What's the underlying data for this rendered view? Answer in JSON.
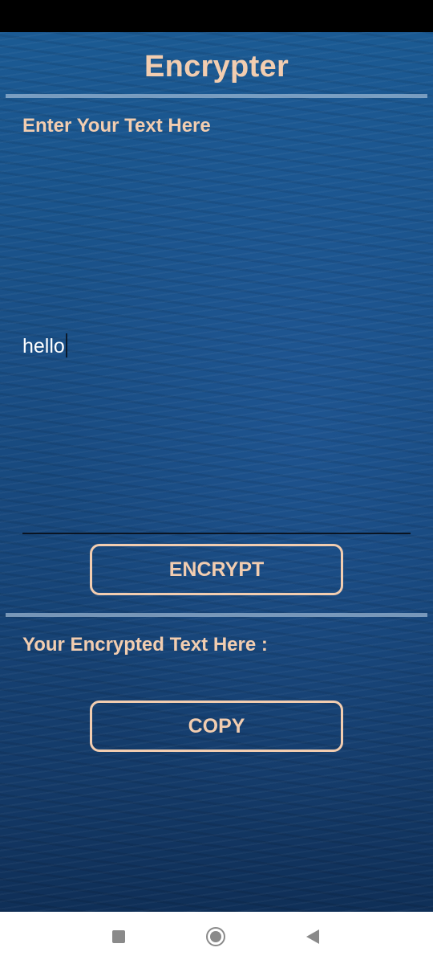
{
  "app": {
    "title": "Encrypter"
  },
  "input": {
    "label": "Enter Your Text Here",
    "value": "hello"
  },
  "buttons": {
    "encrypt_label": "ENCRYPT",
    "copy_label": "COPY"
  },
  "output": {
    "label": "Your Encrypted Text Here :",
    "value": ""
  },
  "navigation": {
    "items": [
      "recent-apps-icon",
      "home-icon",
      "back-icon"
    ]
  },
  "colors": {
    "accent": "#f2cdb0",
    "background": "#1a4f86",
    "nav_bar": "#ffffff"
  }
}
